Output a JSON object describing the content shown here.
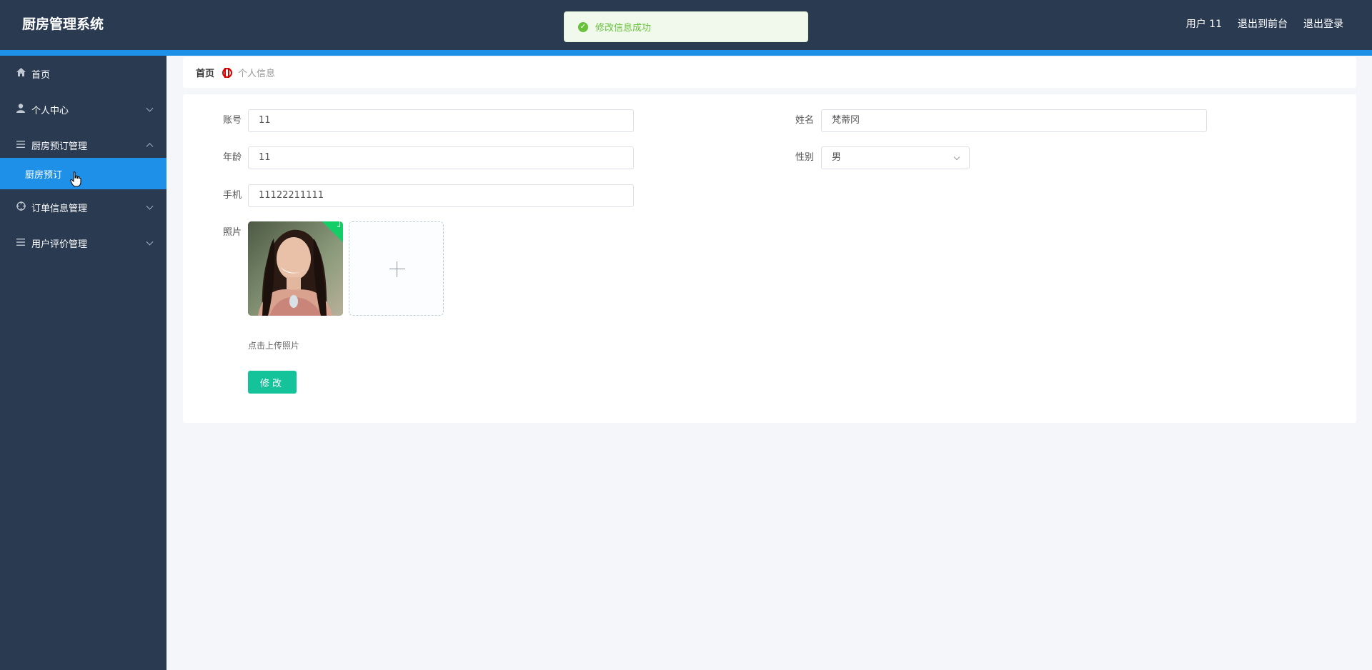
{
  "app": {
    "title": "厨房管理系统"
  },
  "header": {
    "user": "用户 11",
    "to_front": "退出到前台",
    "logout": "退出登录"
  },
  "toast": {
    "message": "修改信息成功",
    "status_color": "#67c23a"
  },
  "sidebar": {
    "items": [
      {
        "label": "首页",
        "icon": "home-icon"
      },
      {
        "label": "个人中心",
        "icon": "user-icon"
      },
      {
        "label": "厨房预订管理",
        "icon": "menu-list-icon",
        "expanded": true
      },
      {
        "label": "订单信息管理",
        "icon": "target-icon"
      },
      {
        "label": "用户评价管理",
        "icon": "menu-list-icon"
      }
    ],
    "active_sub": {
      "label": "厨房预订"
    }
  },
  "breadcrumb": {
    "home": "首页",
    "current": "个人信息"
  },
  "form": {
    "account": {
      "label": "账号",
      "value": "11"
    },
    "name": {
      "label": "姓名",
      "value": "梵蒂冈"
    },
    "age": {
      "label": "年龄",
      "value": "11"
    },
    "gender": {
      "label": "性别",
      "value": "男"
    },
    "phone": {
      "label": "手机",
      "value": "11122211111"
    },
    "photo": {
      "label": "照片",
      "hint": "点击上传照片"
    },
    "submit": "修改"
  },
  "colors": {
    "sidebar_bg": "#2a3a51",
    "accent": "#1e90e8",
    "button": "#15c39a"
  }
}
